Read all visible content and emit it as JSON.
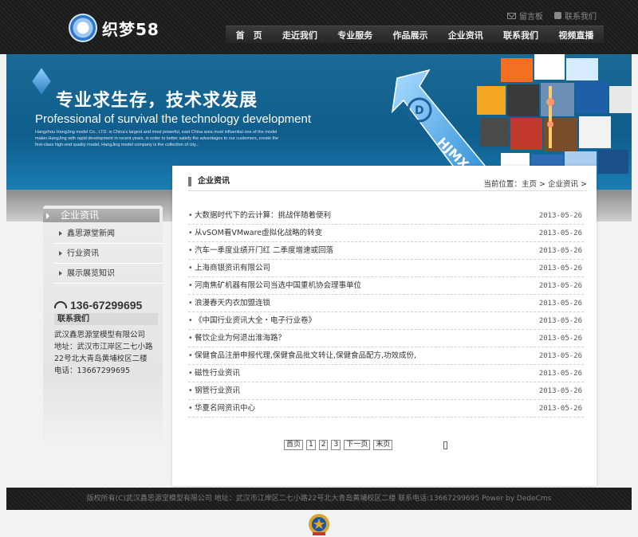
{
  "header": {
    "logo_text": "织梦58",
    "top_links": [
      {
        "label": "留言板",
        "icon": "mail-icon"
      },
      {
        "label": "联系我们",
        "icon": "phone-icon"
      }
    ],
    "nav": [
      "首　页",
      "走近我们",
      "专业服务",
      "作品展示",
      "企业资讯",
      "联系我们",
      "视频直播"
    ]
  },
  "banner": {
    "cn_part1": "专业求生存，",
    "cn_part2": "技术求发展",
    "en": "Professional of survival the technology development",
    "small": "Hangzhou HangJing model Co., LTD. is China's largest and most powerful, east China area most influential one of the model maker.HangJing with rapid development in recent years, in order to better satisfy the advantages to our customers, create the first-class high-end quality model, HangJing model company is the collection of city...",
    "logo_label": "HJMX"
  },
  "sidebar": {
    "title": "企业资讯",
    "items": [
      "鑫思源堂新闻",
      "行业资讯",
      "展示展览知识"
    ],
    "phone": "136-67299695",
    "contact_title": "联系我们",
    "contact_lines": [
      "武汉鑫思源堂模型有限公司",
      "地址：武汉市江岸区二七小路",
      "22号北大青岛黄埔校区二楼",
      "电话：13667299695"
    ]
  },
  "main": {
    "title": "企业资讯",
    "breadcrumb_prefix": "当前位置：",
    "breadcrumb": [
      "主页",
      "企业资讯"
    ],
    "sep": ">",
    "news": [
      {
        "title": "大数据时代下的云计算：挑战伴随着便利",
        "date": "2013-05-26"
      },
      {
        "title": "从vSOM看VMware虚拟化战略的转变",
        "date": "2013-05-26"
      },
      {
        "title": "汽车一季度业绩开门红 二季度增速或回落",
        "date": "2013-05-26"
      },
      {
        "title": "上海商银资讯有限公司",
        "date": "2013-05-26"
      },
      {
        "title": "河南焦矿机器有限公司当选中国重机协会理事单位",
        "date": "2013-05-26"
      },
      {
        "title": "浪漫春天内衣加盟连锁",
        "date": "2013-05-26"
      },
      {
        "title": "《中国行业资讯大全・电子行业卷》",
        "date": "2013-05-26"
      },
      {
        "title": "餐饮企业为何退出淮海路？",
        "date": "2013-05-26"
      },
      {
        "title": "保健食品注册申报代理,保健食品批文转让,保健食品配方,功效成份,",
        "date": "2013-05-26"
      },
      {
        "title": "磁性行业资讯",
        "date": "2013-05-26"
      },
      {
        "title": "钢管行业资讯",
        "date": "2013-05-26"
      },
      {
        "title": "华夏名网资讯中心",
        "date": "2013-05-26"
      }
    ],
    "pager": [
      "首页",
      "1",
      "2",
      "3",
      "下一页",
      "末页"
    ]
  },
  "footer": {
    "text": "版权所有(C)武汉鑫思源堂模型有限公司 地址：武汉市江岸区二七小路22号北大青岛黄埔校区二楼 联系电话:13667299695 Power by DedeCms"
  }
}
